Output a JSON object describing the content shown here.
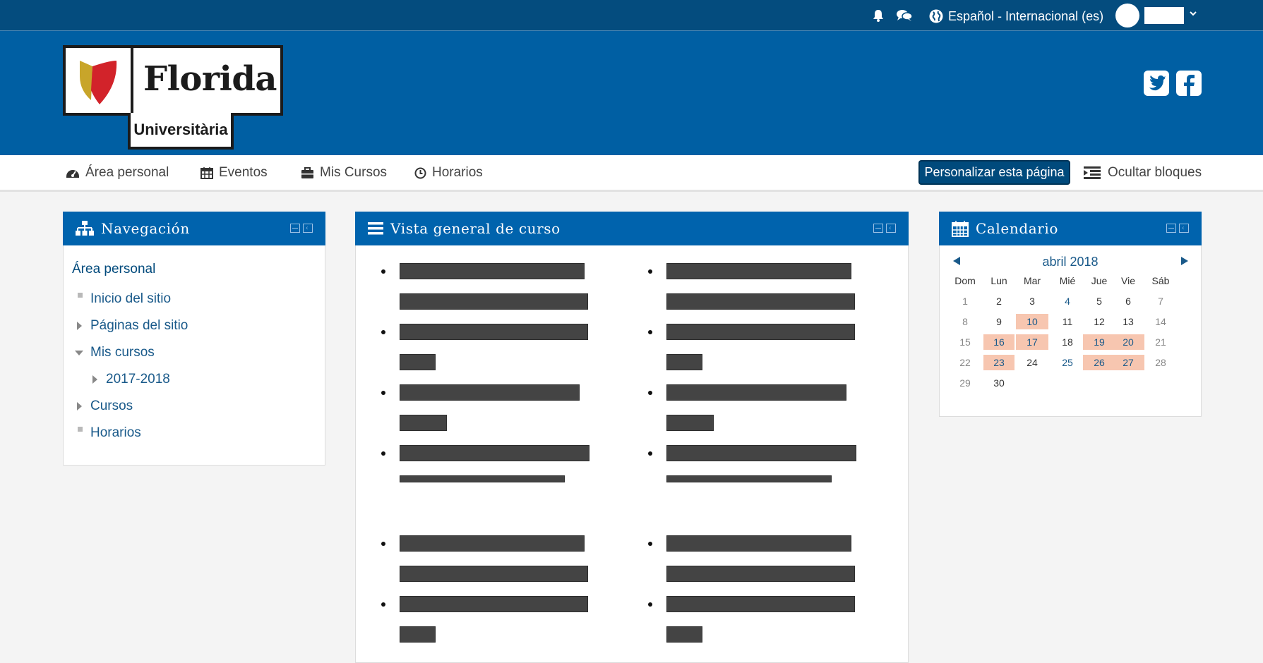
{
  "topbar": {
    "language": "Español - Internacional (es)",
    "icons": [
      "bell-icon",
      "messages-icon",
      "globe-icon",
      "chevron-down-icon"
    ]
  },
  "header": {
    "logo_word": "Florida",
    "logo_sub": "Universitària",
    "social": [
      "twitter-icon",
      "facebook-icon"
    ]
  },
  "navbar": {
    "items": [
      {
        "label": "Área personal",
        "icon": "dashboard-icon"
      },
      {
        "label": "Eventos",
        "icon": "calendar-icon"
      },
      {
        "label": "Mis Cursos",
        "icon": "briefcase-icon"
      },
      {
        "label": "Horarios",
        "icon": "clock-icon"
      }
    ],
    "personalize_label": "Personalizar esta página",
    "hide_blocks_label": "Ocultar bloques"
  },
  "navigation_block": {
    "title": "Navegación",
    "root": "Área personal",
    "items": [
      {
        "label": "Inicio del sitio",
        "type": "leaf"
      },
      {
        "label": "Páginas del sitio",
        "type": "collapsed"
      },
      {
        "label": "Mis cursos",
        "type": "expanded"
      },
      {
        "label": "2017-2018",
        "type": "collapsed",
        "indent": 1
      },
      {
        "label": "Cursos",
        "type": "collapsed"
      },
      {
        "label": "Horarios",
        "type": "leaf"
      }
    ]
  },
  "overview_block": {
    "title": "Vista general de curso"
  },
  "calendar_block": {
    "title": "Calendario",
    "month": "abril 2018",
    "weekdays": [
      "Dom",
      "Lun",
      "Mar",
      "Mié",
      "Jue",
      "Vie",
      "Sáb"
    ],
    "weeks": [
      [
        "1",
        "2",
        "3",
        "4",
        "5",
        "6",
        "7"
      ],
      [
        "8",
        "9",
        "10",
        "11",
        "12",
        "13",
        "14"
      ],
      [
        "15",
        "16",
        "17",
        "18",
        "19",
        "20",
        "21"
      ],
      [
        "22",
        "23",
        "24",
        "25",
        "26",
        "27",
        "28"
      ],
      [
        "29",
        "30",
        "",
        "",
        "",
        "",
        ""
      ]
    ],
    "event_days": [
      "10",
      "16",
      "17",
      "19",
      "20",
      "23",
      "26",
      "27"
    ],
    "link_days": [
      "4",
      "25"
    ],
    "colors": {
      "event": "#f7c6b0",
      "header": "#0063ad"
    }
  }
}
